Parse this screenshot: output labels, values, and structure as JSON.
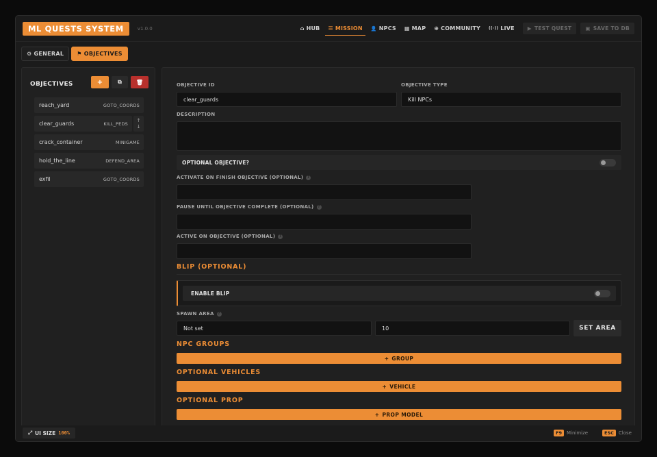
{
  "app": {
    "logo": "ML QUESTS SYSTEM",
    "version": "v1.0.0"
  },
  "nav": {
    "items": [
      {
        "label": "HUB",
        "icon": "home-icon",
        "glyph": "⌂"
      },
      {
        "label": "MISSION",
        "icon": "list-icon",
        "glyph": "☰"
      },
      {
        "label": "NPCS",
        "icon": "user-icon",
        "glyph": "👤"
      },
      {
        "label": "MAP",
        "icon": "map-icon",
        "glyph": "▦"
      },
      {
        "label": "COMMUNITY",
        "icon": "globe-icon",
        "glyph": "⊕"
      },
      {
        "label": "LIVE",
        "icon": "broadcast-icon",
        "glyph": "((·))"
      }
    ],
    "test_quest": {
      "label": "TEST QUEST",
      "glyph": "▶"
    },
    "save_db": {
      "label": "SAVE TO DB",
      "glyph": "▣"
    }
  },
  "tabs": {
    "general": {
      "label": "GENERAL",
      "glyph": "⚙"
    },
    "objectives": {
      "label": "OBJECTIVES",
      "glyph": "⚑"
    }
  },
  "objectives_panel": {
    "title": "OBJECTIVES",
    "add_glyph": "+",
    "copy_glyph": "⧉",
    "delete_glyph": "🗑",
    "up_glyph": "↑",
    "down_glyph": "↓",
    "items": [
      {
        "name": "reach_yard",
        "type": "GOTO_COORDS"
      },
      {
        "name": "clear_guards",
        "type": "KILL_PEDS"
      },
      {
        "name": "crack_container",
        "type": "MINIGAME"
      },
      {
        "name": "hold_the_line",
        "type": "DEFEND_AREA"
      },
      {
        "name": "exfil",
        "type": "GOTO_COORDS"
      }
    ]
  },
  "form": {
    "objective_id": {
      "label": "OBJECTIVE ID",
      "value": "clear_guards"
    },
    "objective_type": {
      "label": "OBJECTIVE TYPE",
      "value": "Kill NPCs"
    },
    "description": {
      "label": "DESCRIPTION",
      "value": ""
    },
    "optional": {
      "label": "OPTIONAL OBJECTIVE?"
    },
    "activate_on_finish": {
      "label": "ACTIVATE ON FINISH OBJECTIVE (OPTIONAL)",
      "value": ""
    },
    "pause_until": {
      "label": "PAUSE UNTIL OBJECTIVE COMPLETE (OPTIONAL)",
      "value": ""
    },
    "active_on": {
      "label": "ACTIVE ON OBJECTIVE (OPTIONAL)",
      "value": ""
    },
    "help_glyph": "?"
  },
  "blip": {
    "title": "BLIP (OPTIONAL)",
    "enable_label": "ENABLE BLIP",
    "spawn_area_label": "SPAWN AREA",
    "spawn_area_value": "Not set",
    "radius_value": "10",
    "set_area_label": "SET AREA"
  },
  "npc_groups": {
    "title": "NPC GROUPS",
    "button": "GROUP"
  },
  "vehicles": {
    "title": "OPTIONAL VEHICLES",
    "button": "VEHICLE"
  },
  "prop": {
    "title": "OPTIONAL PROP",
    "button": "PROP MODEL"
  },
  "plus_glyph": "+",
  "footer": {
    "ui_size_label": "UI SIZE",
    "ui_size_value": "100%",
    "resize_glyph": "⤢",
    "minimize_key": "F9",
    "minimize_label": "Minimize",
    "close_key": "ESC",
    "close_label": "Close"
  },
  "colors": {
    "accent": "#ec8d35",
    "danger": "#b8302c",
    "background": "#1b1b1b"
  }
}
